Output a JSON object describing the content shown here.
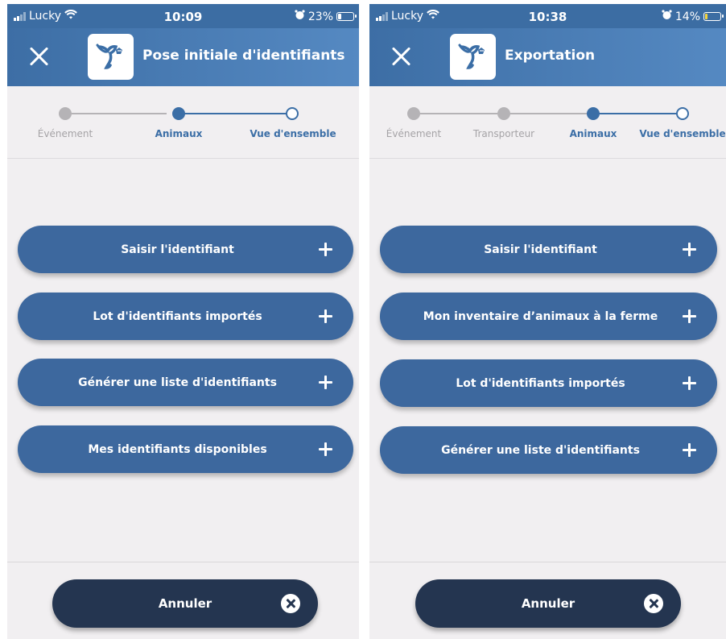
{
  "screens": [
    {
      "status": {
        "carrier": "Lucky",
        "time": "10:09",
        "battery": "23%",
        "battery_level": 0.23,
        "battery_color": "#ffffff"
      },
      "header": {
        "title": "Pose initiale d'identifiants",
        "close_icon": "close-icon",
        "logo_icon": "app-logo-icon"
      },
      "steps": [
        {
          "label": "Événement",
          "state": "done"
        },
        {
          "label": "Animaux",
          "state": "active"
        },
        {
          "label": "Vue d'ensemble",
          "state": "todo"
        }
      ],
      "actions": [
        {
          "label": "Saisir l'identifiant",
          "icon": "plus-icon"
        },
        {
          "label": "Lot d'identifiants importés",
          "icon": "plus-icon"
        },
        {
          "label": "Générer une liste d'identifiants",
          "icon": "plus-icon"
        },
        {
          "label": "Mes identifiants disponibles",
          "icon": "plus-icon"
        }
      ],
      "cancel": {
        "label": "Annuler",
        "icon": "close-circle-icon"
      }
    },
    {
      "status": {
        "carrier": "Lucky",
        "time": "10:38",
        "battery": "14%",
        "battery_level": 0.14,
        "battery_color": "#f5d43a"
      },
      "header": {
        "title": "Exportation",
        "close_icon": "close-icon",
        "logo_icon": "app-logo-icon"
      },
      "steps": [
        {
          "label": "Événement",
          "state": "done"
        },
        {
          "label": "Transporteur",
          "state": "done"
        },
        {
          "label": "Animaux",
          "state": "active"
        },
        {
          "label": "Vue d'ensemble",
          "state": "todo"
        }
      ],
      "actions": [
        {
          "label": "Saisir l'identifiant",
          "icon": "plus-icon"
        },
        {
          "label": "Mon inventaire d’animaux à la ferme",
          "icon": "plus-icon"
        },
        {
          "label": "Lot d'identifiants importés",
          "icon": "plus-icon"
        },
        {
          "label": "Générer une liste d'identifiants",
          "icon": "plus-icon"
        }
      ],
      "cancel": {
        "label": "Annuler",
        "icon": "close-circle-icon"
      }
    }
  ],
  "colors": {
    "header": "#3d6ea5",
    "accent": "#3b6ea6",
    "button": "#3d689e",
    "cancel_button": "#243550",
    "step_done": "#b5b3b6",
    "background": "#f1eff1"
  }
}
